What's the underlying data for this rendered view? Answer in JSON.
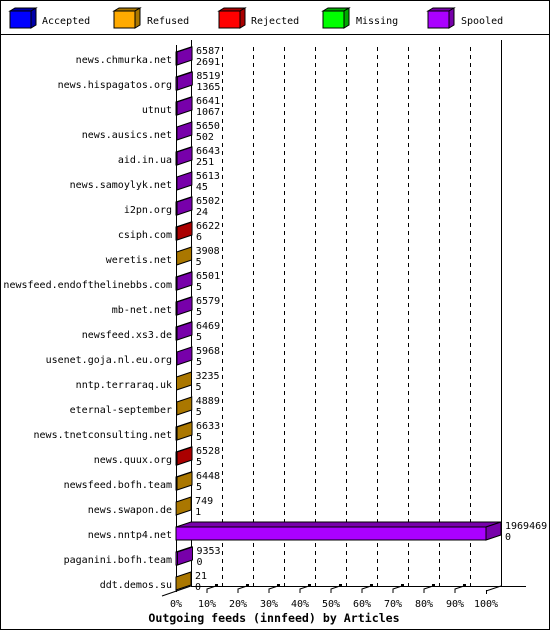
{
  "legend": [
    {
      "label": "Accepted",
      "color": "#0000ff",
      "side": "#0000aa"
    },
    {
      "label": "Refused",
      "color": "#ffaa00",
      "side": "#aa7700"
    },
    {
      "label": "Rejected",
      "color": "#ff0000",
      "side": "#aa0000"
    },
    {
      "label": "Missing",
      "color": "#00ff00",
      "side": "#00aa00"
    },
    {
      "label": "Spooled",
      "color": "#aa00ff",
      "side": "#7700aa"
    }
  ],
  "chart_data": {
    "type": "bar",
    "orientation": "horizontal",
    "stacked": true,
    "style": "3d",
    "title": "Outgoing feeds (innfeed) by Articles",
    "xlabel": "Outgoing feeds (innfeed) by Articles",
    "ylabel": "",
    "xlim": [
      0,
      100
    ],
    "x_unit": "percent of largest feed",
    "x_ticks": [
      "0%",
      "10%",
      "20%",
      "30%",
      "40%",
      "50%",
      "60%",
      "70%",
      "80%",
      "90%",
      "100%"
    ],
    "grid": true,
    "legend_position": "top",
    "categories": [
      "news.chmurka.net",
      "news.hispagatos.org",
      "utnut",
      "news.ausics.net",
      "aid.in.ua",
      "news.samoylyk.net",
      "i2pn.org",
      "csiph.com",
      "weretis.net",
      "newsfeed.endofthelinebbs.com",
      "mb-net.net",
      "newsfeed.xs3.de",
      "usenet.goja.nl.eu.org",
      "nntp.terraraq.uk",
      "eternal-september",
      "news.tnetconsulting.net",
      "news.quux.org",
      "newsfeed.bofh.team",
      "news.swapon.de",
      "news.nntp4.net",
      "paganini.bofh.team",
      "ddt.demos.su"
    ],
    "values": [
      6587,
      8519,
      6641,
      5650,
      6643,
      5613,
      6502,
      6622,
      3908,
      6501,
      6579,
      6469,
      5968,
      3235,
      4889,
      6633,
      6528,
      6448,
      749,
      1969469,
      9353,
      21
    ],
    "labels_top": [
      "6587",
      "8519",
      "6641",
      "5650",
      "6643",
      "5613",
      "6502",
      "6622",
      "3908",
      "6501",
      "6579",
      "6469",
      "5968",
      "3235",
      "4889",
      "6633",
      "6528",
      "6448",
      "749",
      "1969469",
      "9353",
      "21"
    ],
    "labels_bottom": [
      "2691",
      "1365",
      "1067",
      "502",
      "251",
      "45",
      "24",
      "6",
      "5",
      "5",
      "5",
      "5",
      "5",
      "5",
      "5",
      "5",
      "5",
      "5",
      "1",
      "0",
      "0",
      "0"
    ],
    "visible_segment": [
      "Spooled",
      "Spooled",
      "Spooled",
      "Spooled",
      "Spooled",
      "Spooled",
      "Spooled",
      "Rejected",
      "Refused",
      "Spooled",
      "Spooled",
      "Spooled",
      "Spooled",
      "Refused",
      "Refused",
      "Refused",
      "Rejected",
      "Refused",
      "Refused",
      "Spooled",
      "Spooled",
      "Refused"
    ]
  }
}
